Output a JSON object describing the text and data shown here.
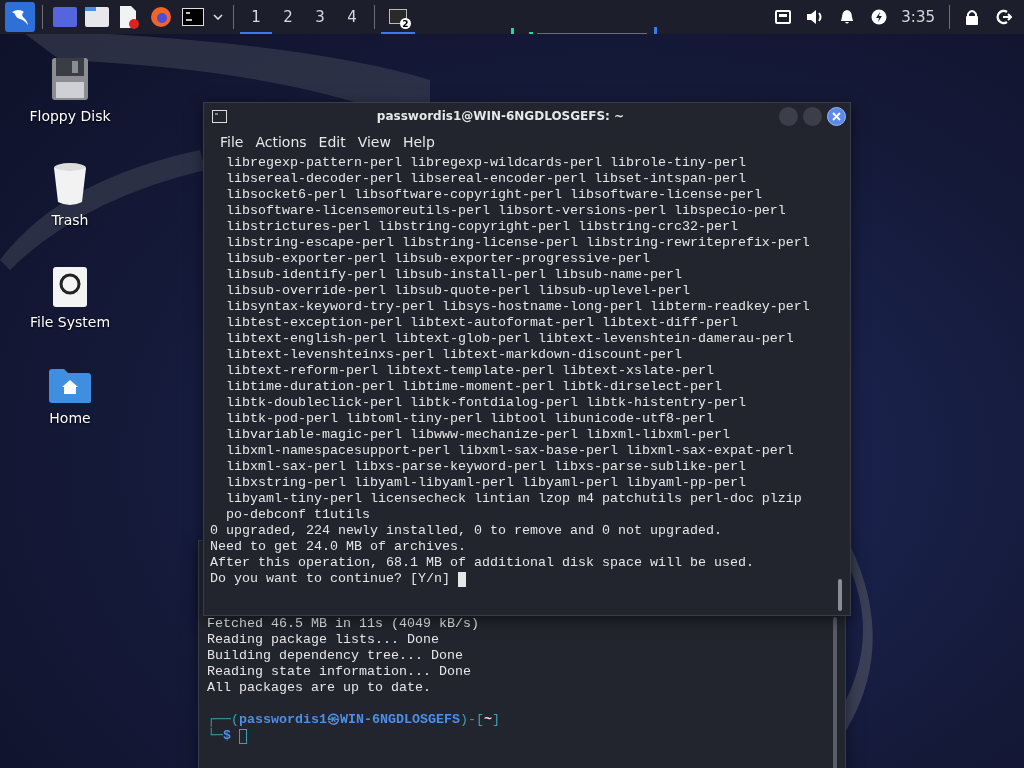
{
  "taskbar": {
    "workspaces": [
      {
        "label": "1",
        "selected": true
      },
      {
        "label": "2",
        "selected": false
      },
      {
        "label": "3",
        "selected": false
      },
      {
        "label": "4",
        "selected": false
      }
    ],
    "task": {
      "badge": "2",
      "selected": true
    },
    "clock": "3:35"
  },
  "desktop_icons": [
    {
      "label": "Floppy Disk",
      "kind": "drive"
    },
    {
      "label": "Trash",
      "kind": "trash"
    },
    {
      "label": "File System",
      "kind": "disk"
    },
    {
      "label": "Home",
      "kind": "folder"
    }
  ],
  "back_window": {
    "lines": [
      "Fetched 46.5 MB in 11s (4049 kB/s)",
      "Reading package lists... Done",
      "Building dependency tree... Done",
      "Reading state information... Done",
      "All packages are up to date."
    ],
    "prompt": {
      "open": "┌──(",
      "user": "passwordis1",
      "at": "㉿",
      "host": "WIN-6NGDLOSGEFS",
      "mid": ")-[",
      "dir": "~",
      "close": "]",
      "second": "└─",
      "dollar": "$"
    }
  },
  "front_window": {
    "title": "passwordis1@WIN-6NGDLOSGEFS: ~",
    "menu": [
      "File",
      "Actions",
      "Edit",
      "View",
      "Help"
    ],
    "lines": [
      "  libregexp-pattern-perl libregexp-wildcards-perl librole-tiny-perl",
      "  libsereal-decoder-perl libsereal-encoder-perl libset-intspan-perl",
      "  libsocket6-perl libsoftware-copyright-perl libsoftware-license-perl",
      "  libsoftware-licensemoreutils-perl libsort-versions-perl libspecio-perl",
      "  libstrictures-perl libstring-copyright-perl libstring-crc32-perl",
      "  libstring-escape-perl libstring-license-perl libstring-rewriteprefix-perl",
      "  libsub-exporter-perl libsub-exporter-progressive-perl",
      "  libsub-identify-perl libsub-install-perl libsub-name-perl",
      "  libsub-override-perl libsub-quote-perl libsub-uplevel-perl",
      "  libsyntax-keyword-try-perl libsys-hostname-long-perl libterm-readkey-perl",
      "  libtest-exception-perl libtext-autoformat-perl libtext-diff-perl",
      "  libtext-english-perl libtext-glob-perl libtext-levenshtein-damerau-perl",
      "  libtext-levenshteinxs-perl libtext-markdown-discount-perl",
      "  libtext-reform-perl libtext-template-perl libtext-xslate-perl",
      "  libtime-duration-perl libtime-moment-perl libtk-dirselect-perl",
      "  libtk-doubleclick-perl libtk-fontdialog-perl libtk-histentry-perl",
      "  libtk-pod-perl libtoml-tiny-perl libtool libunicode-utf8-perl",
      "  libvariable-magic-perl libwww-mechanize-perl libxml-libxml-perl",
      "  libxml-namespacesupport-perl libxml-sax-base-perl libxml-sax-expat-perl",
      "  libxml-sax-perl libxs-parse-keyword-perl libxs-parse-sublike-perl",
      "  libxstring-perl libyaml-libyaml-perl libyaml-perl libyaml-pp-perl",
      "  libyaml-tiny-perl licensecheck lintian lzop m4 patchutils perl-doc plzip",
      "  po-debconf t1utils",
      "0 upgraded, 224 newly installed, 0 to remove and 0 not upgraded.",
      "Need to get 24.0 MB of archives.",
      "After this operation, 68.1 MB of additional disk space will be used.",
      "Do you want to continue? [Y/n] "
    ],
    "cursor": true
  }
}
